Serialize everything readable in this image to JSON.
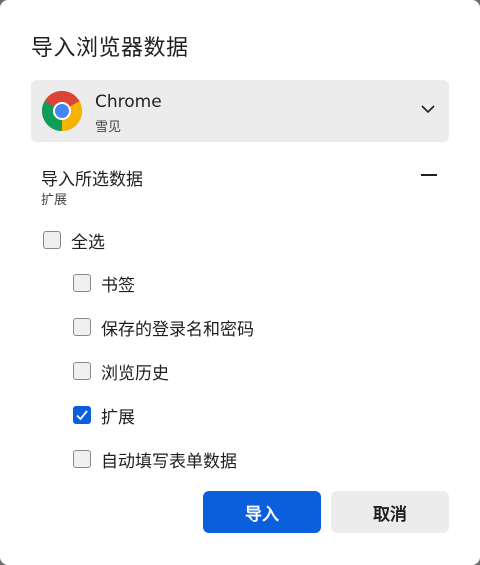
{
  "dialog": {
    "title": "导入浏览器数据"
  },
  "profile_select": {
    "browser": "Chrome",
    "profile": "雪见",
    "icon": "chrome-logo",
    "expand_icon": "chevron-down-icon"
  },
  "section": {
    "header": "导入所选数据",
    "summary": "扩展",
    "toggle_icon": "minus-icon"
  },
  "options": {
    "select_all": {
      "label": "全选",
      "checked": false
    },
    "items": [
      {
        "label": "书签",
        "checked": false
      },
      {
        "label": "保存的登录名和密码",
        "checked": false
      },
      {
        "label": "浏览历史",
        "checked": false
      },
      {
        "label": "扩展",
        "checked": true
      },
      {
        "label": "自动填写表单数据",
        "checked": false
      }
    ]
  },
  "buttons": {
    "import_label": "导入",
    "cancel_label": "取消"
  },
  "colors": {
    "accent": "#0a5fdc",
    "panel": "#ececec",
    "text": "#1f1f1f"
  }
}
